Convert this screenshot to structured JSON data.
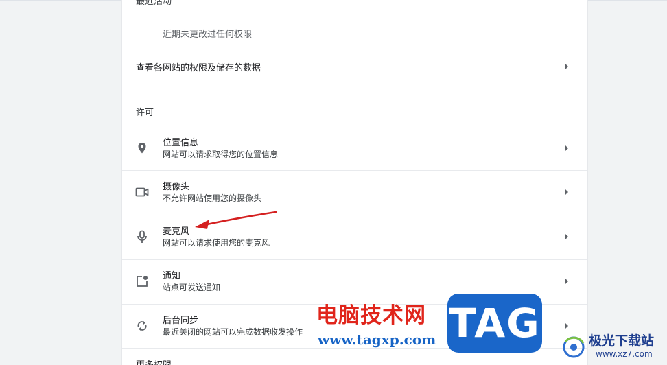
{
  "recent": {
    "title": "最近活动",
    "subtitle": "近期未更改过任何权限"
  },
  "view_all": {
    "label": "查看各网站的权限及储存的数据"
  },
  "permissions": {
    "section_label": "许可",
    "items": [
      {
        "icon": "location-pin-icon",
        "title": "位置信息",
        "desc": "网站可以请求取得您的位置信息"
      },
      {
        "icon": "camera-icon",
        "title": "摄像头",
        "desc": "不允许网站使用您的摄像头"
      },
      {
        "icon": "microphone-icon",
        "title": "麦克风",
        "desc": "网站可以请求使用您的麦克风"
      },
      {
        "icon": "notification-icon",
        "title": "通知",
        "desc": "站点可发送通知"
      },
      {
        "icon": "sync-icon",
        "title": "后台同步",
        "desc": "最近关闭的网站可以完成数据收发操作"
      }
    ]
  },
  "more_permissions": {
    "label": "更多权限"
  },
  "colors": {
    "annotation_arrow": "#d42020",
    "accent_text": "#202124",
    "watermark_red": "#e0251b",
    "watermark_blue": "#1a66c9"
  },
  "watermark": {
    "brand_cn": "电脑技术网",
    "brand_url": "www.tagxp.com",
    "tag": "TAG",
    "site_name": "极光下载站",
    "site_url": "www.xz7.com"
  }
}
